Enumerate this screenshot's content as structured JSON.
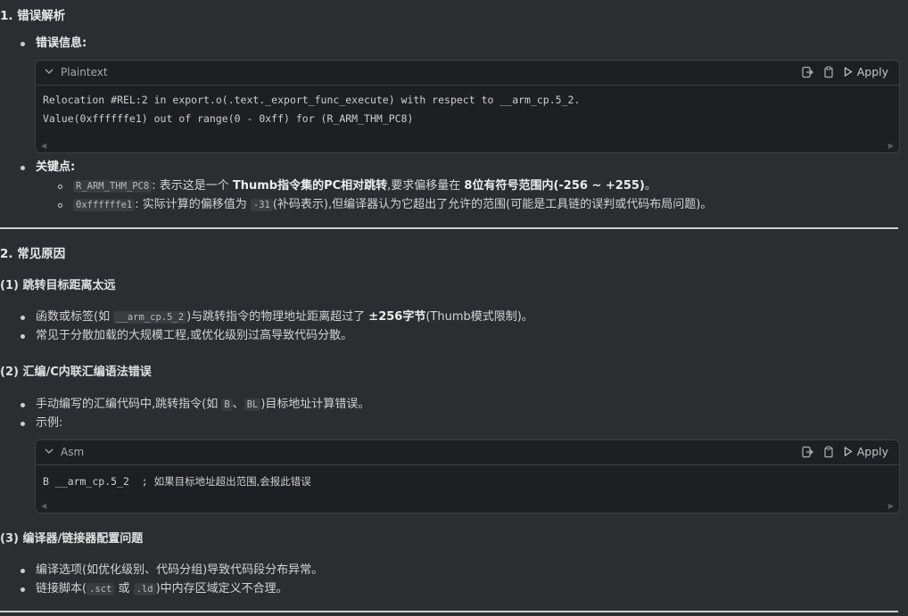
{
  "s1": {
    "title": "1. 错误解析",
    "error_info_label": "错误信息",
    "colon": ":",
    "code1": {
      "lang": "Plaintext",
      "apply": "Apply",
      "line1": "Relocation #REL:2 in export.o(.text._export_func_execute) with respect to __arm_cp.5_2.",
      "line2": "Value(0xffffffe1) out of range(0 - 0xff) for (R_ARM_THM_PC8)"
    },
    "key_label": "关键点",
    "key1": {
      "code": "R_ARM_THM_PC8",
      "t1": ": 表示这是一个 ",
      "b1": "Thumb指令集的PC相对跳转",
      "t2": ",要求偏移量在 ",
      "b2": "8位有符号范围内(-256 ~ +255)",
      "t3": "。"
    },
    "key2": {
      "code": "0xffffffe1",
      "t1": ": 实际计算的偏移值为 ",
      "code2": "-31",
      "t2": "(补码表示),但编译器认为它超出了允许的范围(可能是工具链的误判或代码布局问题)。"
    }
  },
  "s2": {
    "title": "2. 常见原因",
    "sub1": {
      "title": "(1) 跳转目标距离太远",
      "i1": {
        "t1": "函数或标签(如 ",
        "code": "__arm_cp.5_2",
        "t2": ")与跳转指令的物理地址距离超过了 ",
        "b": "±256字节",
        "t3": "(Thumb模式限制)。"
      },
      "i2": "常见于分散加载的大规模工程,或优化级别过高导致代码分散。"
    },
    "sub2": {
      "title": "(2) 汇编/C内联汇编语法错误",
      "i1": {
        "t1": "手动编写的汇编代码中,跳转指令(如 ",
        "c1": "B",
        "sep": "、",
        "c2": "BL",
        "t2": ")目标地址计算错误。"
      },
      "i2": "示例:",
      "code2": {
        "lang": "Asm",
        "apply": "Apply",
        "code": "B __arm_cp.5_2  ; ",
        "comment": "如果目标地址超出范围,会报此错误"
      }
    },
    "sub3": {
      "title": "(3) 编译器/链接器配置问题",
      "i1": "编译选项(如优化级别、代码分组)导致代码段分布异常。",
      "i2": {
        "t1": "链接脚本(",
        "c1": ".sct",
        "t2": " 或 ",
        "c2": ".ld",
        "t3": ")中内存区域定义不合理。"
      }
    }
  }
}
